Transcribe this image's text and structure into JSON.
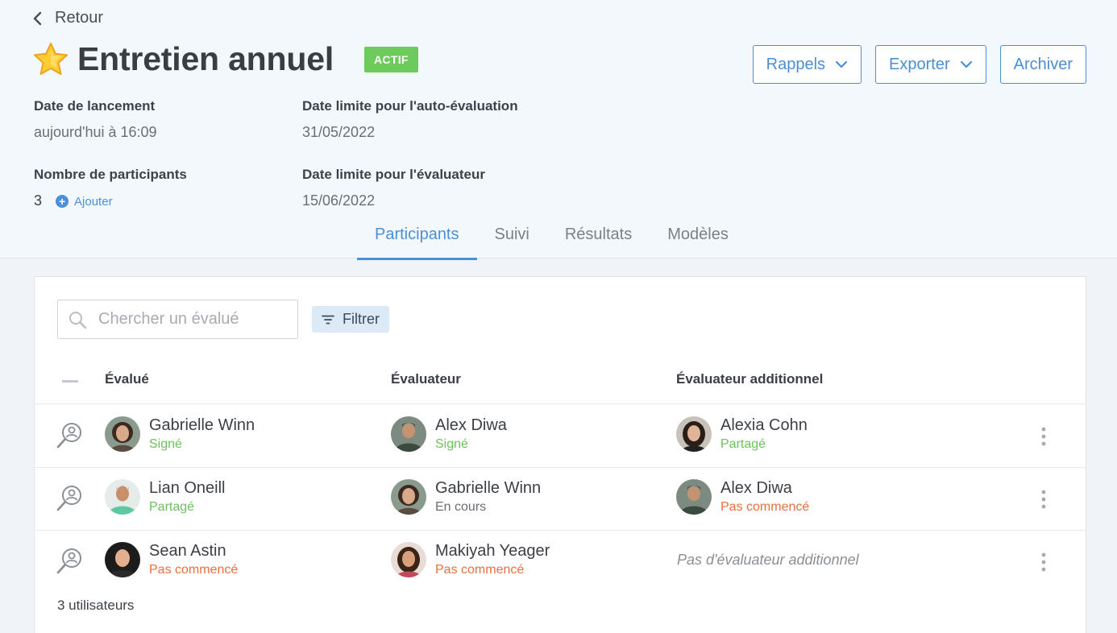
{
  "back": {
    "label": "Retour"
  },
  "header": {
    "title": "Entretien annuel",
    "status_badge": "ACTIF",
    "actions": {
      "reminders": "Rappels",
      "export": "Exporter",
      "archive": "Archiver"
    }
  },
  "meta": {
    "launch_date": {
      "label": "Date de lancement",
      "value": "aujourd'hui à 16:09"
    },
    "self_eval_deadline": {
      "label": "Date limite pour l'auto-évaluation",
      "value": "31/05/2022"
    },
    "participants_count": {
      "label": "Nombre de participants",
      "value": "3",
      "add_label": "Ajouter"
    },
    "evaluator_deadline": {
      "label": "Date limite pour l'évaluateur",
      "value": "15/06/2022"
    }
  },
  "tabs": [
    {
      "label": "Participants",
      "active": true
    },
    {
      "label": "Suivi",
      "active": false
    },
    {
      "label": "Résultats",
      "active": false
    },
    {
      "label": "Modèles",
      "active": false
    }
  ],
  "search": {
    "placeholder": "Chercher un évalué"
  },
  "filter": {
    "label": "Filtrer"
  },
  "table": {
    "columns": [
      "Évalué",
      "Évaluateur",
      "Évaluateur additionnel"
    ],
    "rows": [
      {
        "evaluee": {
          "name": "Gabrielle Winn",
          "status": "Signé"
        },
        "evaluator": {
          "name": "Alex Diwa",
          "status": "Signé"
        },
        "additional": {
          "name": "Alexia Cohn",
          "status": "Partagé"
        }
      },
      {
        "evaluee": {
          "name": "Lian Oneill",
          "status": "Partagé"
        },
        "evaluator": {
          "name": "Gabrielle Winn",
          "status": "En cours"
        },
        "additional": {
          "name": "Alex Diwa",
          "status": "Pas commencé"
        }
      },
      {
        "evaluee": {
          "name": "Sean Astin",
          "status": "Pas commencé"
        },
        "evaluator": {
          "name": "Makiyah Yeager",
          "status": "Pas commencé"
        },
        "additional": {
          "empty_label": "Pas d'évaluateur additionnel"
        }
      }
    ],
    "footer_count": "3 utilisateurs"
  },
  "colors": {
    "accent": "#4a90d9",
    "badge_green": "#6ccb5a",
    "status_green": "#6cc25c",
    "status_orange": "#e8703c"
  },
  "icons": [
    "chevron-left-icon",
    "star-icon",
    "chevron-down-icon",
    "plus-circle-icon",
    "search-icon",
    "filter-icon",
    "user-search-icon",
    "kebab-menu-icon"
  ]
}
